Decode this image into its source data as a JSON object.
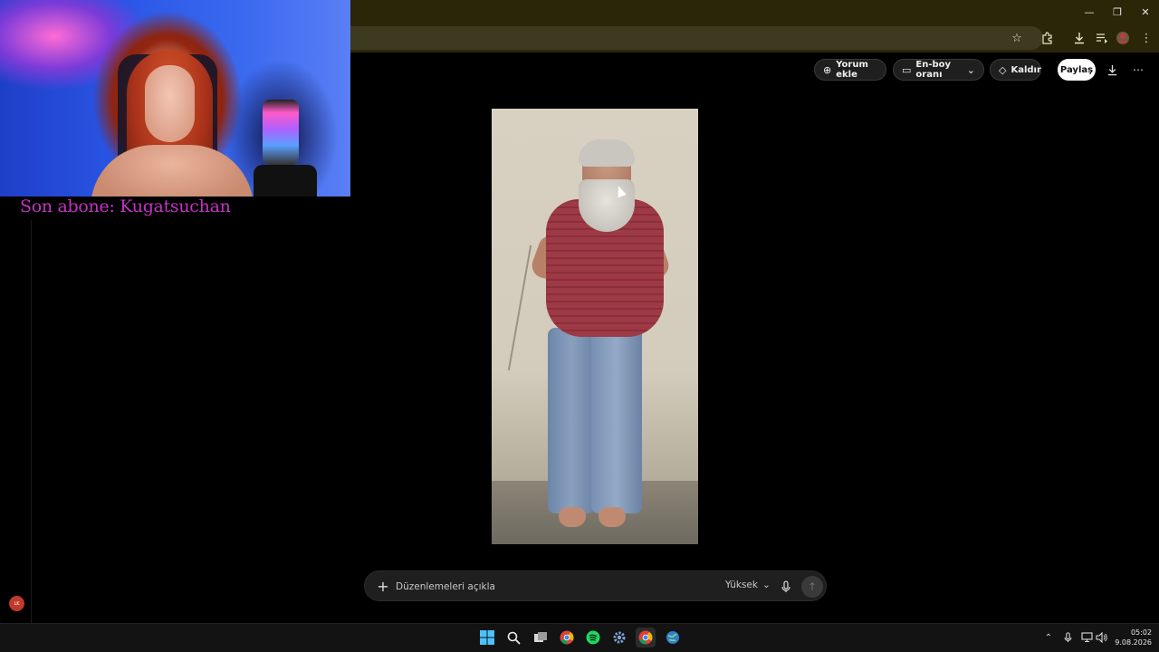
{
  "overlay": {
    "subscriber_text": "Son abone: Kugatsuchan",
    "badge_initials": "LK"
  },
  "window": {
    "minimize": "—",
    "restore": "❐",
    "close": "✕"
  },
  "page_toolbar": {
    "comment_label": "Yorum ekle",
    "aspect_label": "En-boy oranı",
    "remove_label": "Kaldır",
    "share_label": "Paylaş"
  },
  "prompt": {
    "placeholder": "Düzenlemeleri açıkla",
    "quality": "Yüksek"
  },
  "taskbar": {
    "time": "05:02",
    "date": "9.08.2026"
  },
  "icons": {
    "star": "star-icon",
    "extensions": "puzzle-icon",
    "download": "download-icon",
    "media": "media-queue-icon",
    "profile": "profile-icon",
    "menu": "kebab-menu-icon"
  },
  "colors": {
    "chrome_bg": "#2b2608",
    "subscriber_text": "#c532c5",
    "share_bg": "#ffffff"
  }
}
